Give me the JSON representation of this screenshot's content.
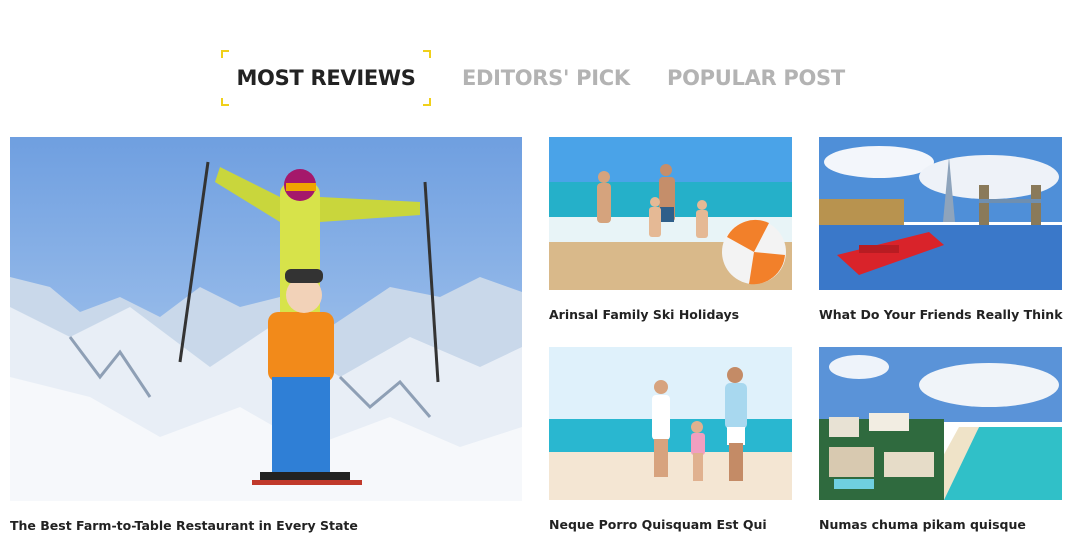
{
  "tabs": [
    {
      "label": "MOST REVIEWS",
      "active": true
    },
    {
      "label": "EDITORS' PICK",
      "active": false
    },
    {
      "label": "POPULAR POST",
      "active": false
    }
  ],
  "accent_color": "#f0d01a",
  "posts": {
    "featured": {
      "title": "The Best Farm-to-Table Restaurant in Every State"
    },
    "p1": {
      "title": "Arinsal Family Ski Holidays"
    },
    "p2": {
      "title": "What Do Your Friends Really Think"
    },
    "p3": {
      "title": "Neque Porro Quisquam Est Qui"
    },
    "p4": {
      "title": "Numas chuma pikam quisque"
    }
  }
}
